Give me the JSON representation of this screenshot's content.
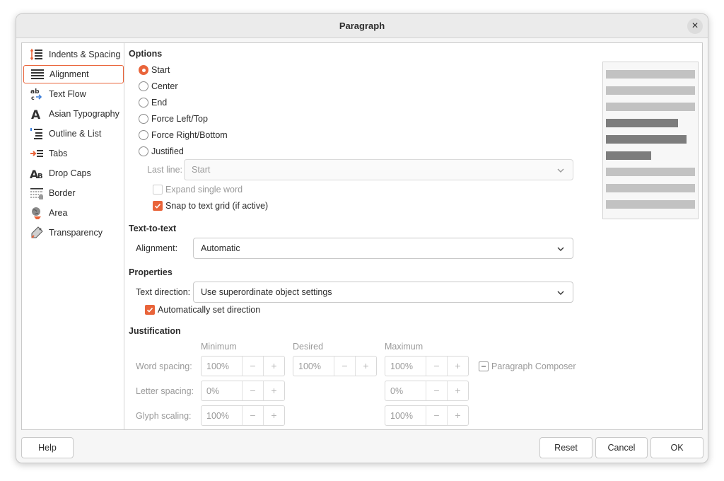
{
  "window": {
    "title": "Paragraph"
  },
  "sidebar": {
    "items": [
      {
        "label": "Indents & Spacing",
        "icon": "indent-spacing-icon"
      },
      {
        "label": "Alignment",
        "icon": "align-justify-icon",
        "active": true
      },
      {
        "label": "Text Flow",
        "icon": "text-flow-icon"
      },
      {
        "label": "Asian Typography",
        "icon": "asian-typography-icon"
      },
      {
        "label": "Outline & List",
        "icon": "outline-list-icon"
      },
      {
        "label": "Tabs",
        "icon": "tabs-icon"
      },
      {
        "label": "Drop Caps",
        "icon": "drop-caps-icon"
      },
      {
        "label": "Border",
        "icon": "border-icon"
      },
      {
        "label": "Area",
        "icon": "area-icon"
      },
      {
        "label": "Transparency",
        "icon": "transparency-icon"
      }
    ]
  },
  "options": {
    "heading": "Options",
    "radios": [
      {
        "label": "Start",
        "checked": true
      },
      {
        "label": "Center",
        "checked": false
      },
      {
        "label": "End",
        "checked": false
      },
      {
        "label": "Force Left/Top",
        "checked": false
      },
      {
        "label": "Force Right/Bottom",
        "checked": false
      },
      {
        "label": "Justified",
        "checked": false
      }
    ],
    "last_line_label": "Last line:",
    "last_line_value": "Start",
    "expand_single_word": "Expand single word",
    "snap_to_grid": "Snap to text grid (if active)"
  },
  "text_to_text": {
    "heading": "Text-to-text",
    "alignment_label": "Alignment:",
    "alignment_value": "Automatic"
  },
  "properties": {
    "heading": "Properties",
    "direction_label": "Text direction:",
    "direction_value": "Use superordinate object settings",
    "auto_direction": "Automatically set direction"
  },
  "justification": {
    "heading": "Justification",
    "columns": {
      "minimum": "Minimum",
      "desired": "Desired",
      "maximum": "Maximum"
    },
    "word_spacing": {
      "label": "Word spacing:",
      "min": "100%",
      "desired": "100%",
      "max": "100%"
    },
    "letter_spacing": {
      "label": "Letter spacing:",
      "min": "0%",
      "max": "0%"
    },
    "glyph_scaling": {
      "label": "Glyph scaling:",
      "min": "100%",
      "max": "100%"
    },
    "paragraph_composer": "Paragraph Composer",
    "spin_minus": "−",
    "spin_plus": "+"
  },
  "buttons": {
    "help": "Help",
    "reset": "Reset",
    "cancel": "Cancel",
    "ok": "OK"
  },
  "colors": {
    "accent": "#e9643a",
    "preview_light": "#c2c2c2",
    "preview_dark": "#7d7d7d"
  }
}
